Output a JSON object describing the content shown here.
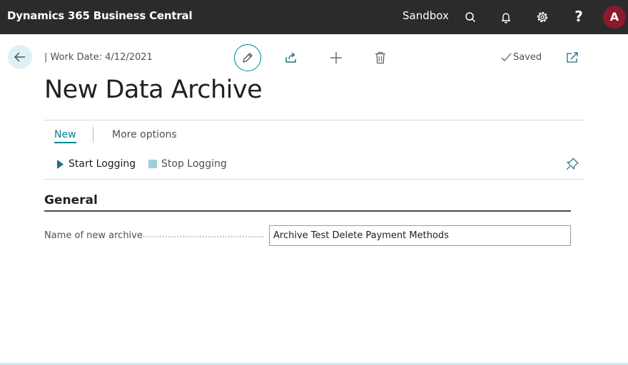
{
  "topbar": {
    "app_title": "Dynamics 365 Business Central",
    "environment": "Sandbox",
    "icons": [
      "search-icon",
      "bell-icon",
      "gear-icon",
      "help-icon"
    ],
    "help_glyph": "?",
    "avatar_initial": "A",
    "colors": {
      "background": "#2b2b2b",
      "avatar": "#8b1a2b"
    }
  },
  "page": {
    "work_date": "| Work Date: 4/12/2021",
    "title": "New Data Archive",
    "status": "Saved",
    "actions": [
      "edit-icon",
      "share-icon",
      "add-icon",
      "delete-icon",
      "popout-icon"
    ]
  },
  "menu": {
    "tabs": [
      {
        "label": "New",
        "active": true
      },
      {
        "label": "More options",
        "active": false
      }
    ],
    "commands": [
      {
        "label": "Start Logging",
        "icon": "play-icon"
      },
      {
        "label": "Stop Logging",
        "icon": "stop-icon"
      }
    ],
    "accent": "#00838f"
  },
  "general": {
    "section_title": "General",
    "fields": [
      {
        "label": "Name of new archive",
        "value": "Archive Test Delete Payment Methods"
      }
    ]
  }
}
